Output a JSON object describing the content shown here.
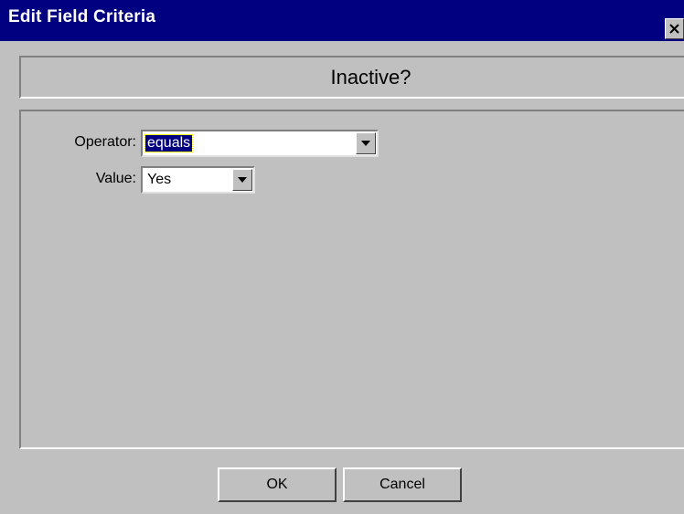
{
  "window": {
    "title": "Edit Field Criteria",
    "close_icon": "close-icon"
  },
  "header": {
    "field_name": "Inactive?"
  },
  "form": {
    "operator_label": "Operator:",
    "operator_value": "equals",
    "value_label": "Value:",
    "value_value": "Yes"
  },
  "buttons": {
    "ok_label": "OK",
    "cancel_label": "Cancel"
  },
  "colors": {
    "titlebar": "#000080",
    "face": "#c0c0c0",
    "selection": "#000080"
  }
}
